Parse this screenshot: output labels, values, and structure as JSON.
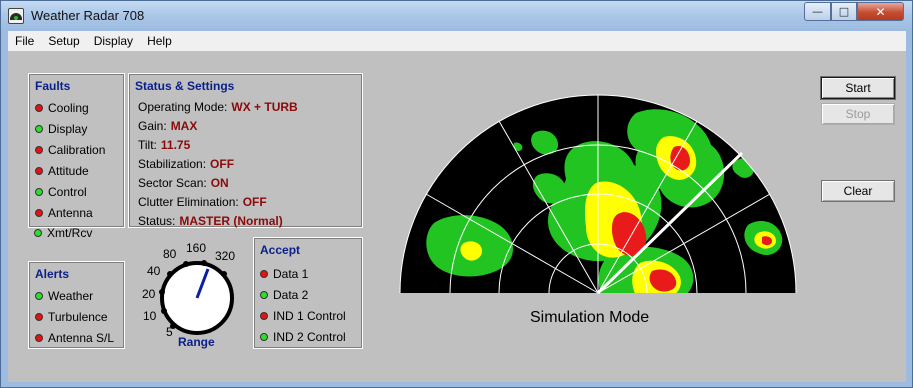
{
  "window": {
    "title": "Weather Radar 708",
    "controls": {
      "minimize": "—",
      "maximize": "□",
      "close": "✕"
    }
  },
  "menu": [
    "File",
    "Setup",
    "Display",
    "Help"
  ],
  "faults": {
    "title": "Faults",
    "items": [
      {
        "label": "Cooling",
        "state": "red"
      },
      {
        "label": "Display",
        "state": "green"
      },
      {
        "label": "Calibration",
        "state": "red"
      },
      {
        "label": "Attitude",
        "state": "red"
      },
      {
        "label": "Control",
        "state": "green"
      },
      {
        "label": "Antenna",
        "state": "red"
      },
      {
        "label": "Xmt/Rcv",
        "state": "green"
      }
    ]
  },
  "status": {
    "title": "Status & Settings",
    "rows": [
      {
        "label": "Operating Mode:",
        "value": "WX + TURB"
      },
      {
        "label": "Gain:",
        "value": "MAX"
      },
      {
        "label": "Tilt:",
        "value": "11.75"
      },
      {
        "label": "Stabilization:",
        "value": "OFF"
      },
      {
        "label": "Sector Scan:",
        "value": "ON"
      },
      {
        "label": "Clutter Elimination:",
        "value": "OFF"
      },
      {
        "label": "Status:",
        "value": "MASTER (Normal)"
      }
    ]
  },
  "alerts": {
    "title": "Alerts",
    "items": [
      {
        "label": "Weather",
        "state": "green"
      },
      {
        "label": "Turbulence",
        "state": "red"
      },
      {
        "label": "Antenna S/L",
        "state": "red"
      }
    ]
  },
  "range": {
    "label": "Range",
    "ticks": [
      "5",
      "10",
      "20",
      "40",
      "80",
      "160",
      "320"
    ],
    "selected": "160"
  },
  "accept": {
    "title": "Accept",
    "items": [
      {
        "label": "Data 1",
        "state": "red"
      },
      {
        "label": "Data 2",
        "state": "green"
      },
      {
        "label": "IND 1 Control",
        "state": "red"
      },
      {
        "label": "IND 2 Control",
        "state": "green"
      }
    ]
  },
  "buttons": {
    "start": "Start",
    "stop": "Stop",
    "clear": "Clear"
  },
  "radar": {
    "mode_label": "Simulation Mode",
    "colors": {
      "background": "#000000",
      "level1": "#22c422",
      "level2": "#ffff00",
      "level3": "#e81a1a",
      "sweep": "#ffffff"
    }
  }
}
